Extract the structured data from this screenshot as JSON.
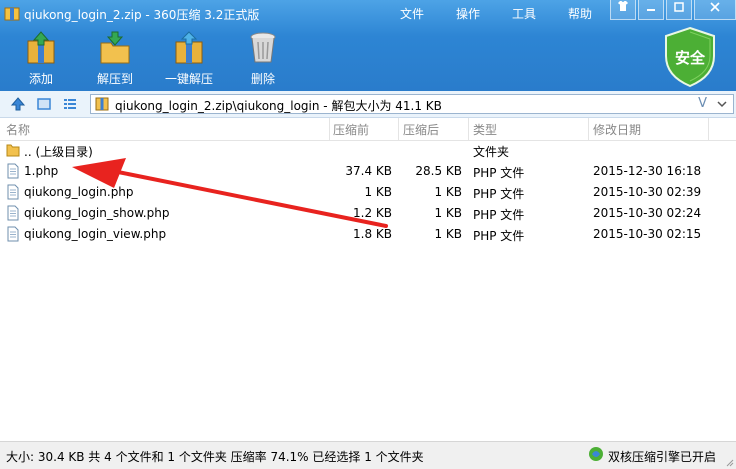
{
  "window": {
    "title": "qiukong_login_2.zip - 360压缩 3.2正式版",
    "menu": [
      "文件",
      "操作",
      "工具",
      "帮助"
    ],
    "controls": [
      "minimize",
      "maximize",
      "close"
    ]
  },
  "toolbar": {
    "items": [
      {
        "label": "添加",
        "icon": "add-archive-icon"
      },
      {
        "label": "解压到",
        "icon": "extract-to-icon"
      },
      {
        "label": "一键解压",
        "icon": "one-click-extract-icon"
      },
      {
        "label": "删除",
        "icon": "trash-bin-icon"
      }
    ],
    "security_label": "安全"
  },
  "address": {
    "path": "qiukong_login_2.zip\\qiukong_login - 解包大小为 41.1 KB",
    "v_label": "V"
  },
  "columns": [
    "名称",
    "压缩前",
    "压缩后",
    "类型",
    "修改日期"
  ],
  "files": [
    {
      "name": ".. (上级目录)",
      "before": "",
      "after": "",
      "type": "文件夹",
      "date": "",
      "kind": "folder"
    },
    {
      "name": "1.php",
      "before": "37.4 KB",
      "after": "28.5 KB",
      "type": "PHP 文件",
      "date": "2015-12-30 16:18",
      "kind": "file"
    },
    {
      "name": "qiukong_login.php",
      "before": "1 KB",
      "after": "1 KB",
      "type": "PHP 文件",
      "date": "2015-10-30 02:39",
      "kind": "file"
    },
    {
      "name": "qiukong_login_show.php",
      "before": "1.2 KB",
      "after": "1 KB",
      "type": "PHP 文件",
      "date": "2015-10-30 02:24",
      "kind": "file"
    },
    {
      "name": "qiukong_login_view.php",
      "before": "1.8 KB",
      "after": "1 KB",
      "type": "PHP 文件",
      "date": "2015-10-30 02:15",
      "kind": "file"
    }
  ],
  "status": {
    "summary": "大小: 30.4 KB 共 4 个文件和 1 个文件夹 压缩率 74.1% 已经选择 1 个文件夹",
    "engine": "双核压缩引擎已开启"
  },
  "colors": {
    "titlebar": "#2d85d4",
    "annotation_arrow": "#e8231f",
    "shield": "#4caf35"
  }
}
